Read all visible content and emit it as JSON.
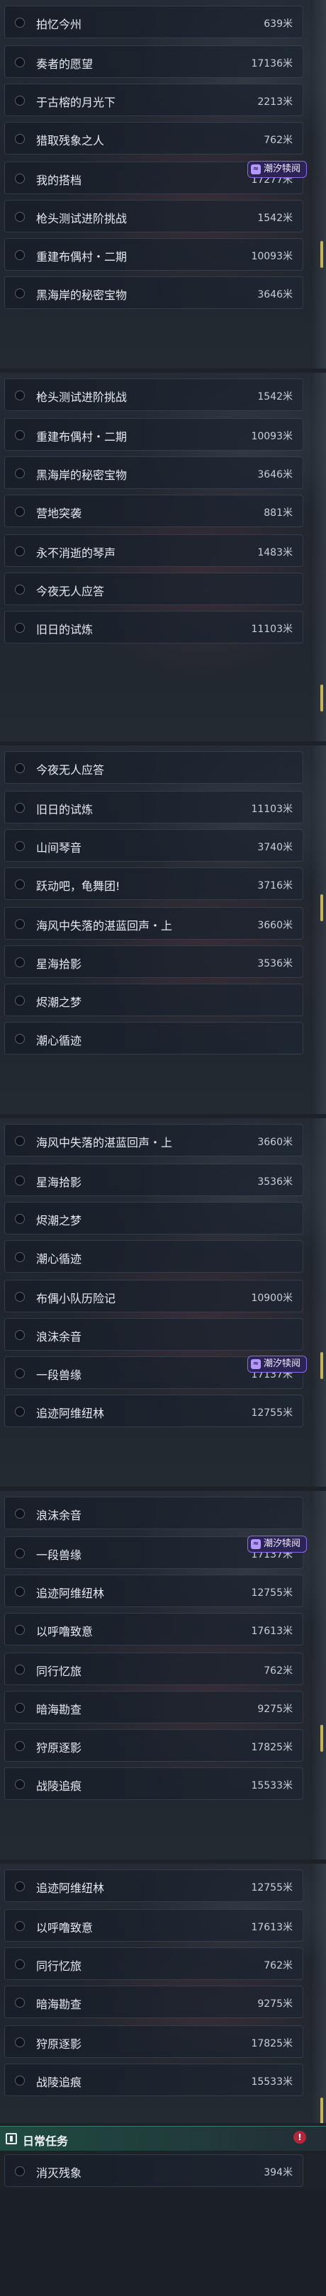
{
  "badge_label": "潮汐犊阋",
  "badge_icon": "tide-event-icon",
  "colors": {
    "accent": "#c9b35a",
    "badge_bg": "#2c2356",
    "section_bg": "#1f4a42",
    "alert": "#b0283a"
  },
  "panels": [
    {
      "items": [
        {
          "name": "拍忆今州",
          "dist": "639米"
        },
        {
          "name": "奏者的愿望",
          "dist": "17136米"
        },
        {
          "name": "于古榕的月光下",
          "dist": "2213米"
        },
        {
          "name": "猎取残象之人",
          "dist": "762米"
        },
        {
          "name": "我的搭档",
          "dist": "17277米",
          "badge": true
        },
        {
          "name": "枪头测试进阶挑战",
          "dist": "1542米"
        },
        {
          "name": "重建布偶村・二期",
          "dist": "10093米"
        },
        {
          "name": "黑海岸的秘密宝物",
          "dist": "3646米"
        }
      ]
    },
    {
      "items": [
        {
          "name": "枪头测试进阶挑战",
          "dist": "1542米"
        },
        {
          "name": "重建布偶村・二期",
          "dist": "10093米"
        },
        {
          "name": "黑海岸的秘密宝物",
          "dist": "3646米"
        },
        {
          "name": "营地突袭",
          "dist": "881米"
        },
        {
          "name": "永不消逝的琴声",
          "dist": "1483米"
        },
        {
          "name": "今夜无人应答",
          "dist": ""
        },
        {
          "name": "旧日的试炼",
          "dist": "11103米"
        }
      ]
    },
    {
      "items": [
        {
          "name": "今夜无人应答",
          "dist": ""
        },
        {
          "name": "旧日的试炼",
          "dist": "11103米"
        },
        {
          "name": "山间琴音",
          "dist": "3740米"
        },
        {
          "name": "跃动吧，龟舞团!",
          "dist": "3716米"
        },
        {
          "name": "海风中失落的湛蓝回声・上",
          "dist": "3660米"
        },
        {
          "name": "星海拾影",
          "dist": "3536米"
        },
        {
          "name": "烬潮之梦",
          "dist": ""
        },
        {
          "name": "潮心循迹",
          "dist": ""
        }
      ]
    },
    {
      "items": [
        {
          "name": "海风中失落的湛蓝回声・上",
          "dist": "3660米"
        },
        {
          "name": "星海拾影",
          "dist": "3536米"
        },
        {
          "name": "烬潮之梦",
          "dist": ""
        },
        {
          "name": "潮心循迹",
          "dist": ""
        },
        {
          "name": "布偶小队历险记",
          "dist": "10900米"
        },
        {
          "name": "浪沫余音",
          "dist": ""
        },
        {
          "name": "一段兽缘",
          "dist": "17137米",
          "badge": true
        },
        {
          "name": "追迹阿维纽林",
          "dist": "12755米"
        }
      ]
    },
    {
      "items": [
        {
          "name": "浪沫余音",
          "dist": ""
        },
        {
          "name": "一段兽缘",
          "dist": "17137米",
          "badge": true
        },
        {
          "name": "追迹阿维纽林",
          "dist": "12755米"
        },
        {
          "name": "以呼噜致意",
          "dist": "17613米"
        },
        {
          "name": "同行忆旅",
          "dist": "762米"
        },
        {
          "name": "暗海勘查",
          "dist": "9275米"
        },
        {
          "name": "狩原逐影",
          "dist": "17825米"
        },
        {
          "name": "战陵追痕",
          "dist": "15533米"
        }
      ]
    },
    {
      "items": [
        {
          "name": "追迹阿维纽林",
          "dist": "12755米"
        },
        {
          "name": "以呼噜致意",
          "dist": "17613米"
        },
        {
          "name": "同行忆旅",
          "dist": "762米"
        },
        {
          "name": "暗海勘查",
          "dist": "9275米"
        },
        {
          "name": "狩原逐影",
          "dist": "17825米"
        },
        {
          "name": "战陵追痕",
          "dist": "15533米"
        }
      ]
    }
  ],
  "daily": {
    "section_title": "日常任务",
    "alert_glyph": "!",
    "item": {
      "name": "消灭残象",
      "dist": "394米"
    }
  }
}
